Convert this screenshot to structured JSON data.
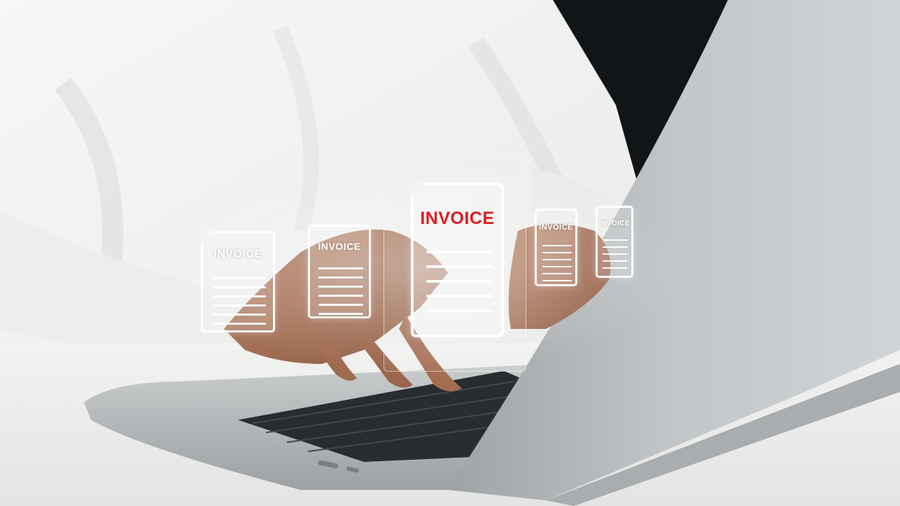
{
  "documents": [
    {
      "title": "INVOICE"
    },
    {
      "title": "INVOICE"
    },
    {
      "title": "INVOICE"
    },
    {
      "title": "INVOICE"
    },
    {
      "title": "INVOICE"
    }
  ],
  "colors": {
    "accent_title": "#e01b22",
    "hologram": "#ffffff",
    "laptop": "#b8bbbd",
    "shirt": "#eeeeee",
    "background_dark": "#111416"
  }
}
